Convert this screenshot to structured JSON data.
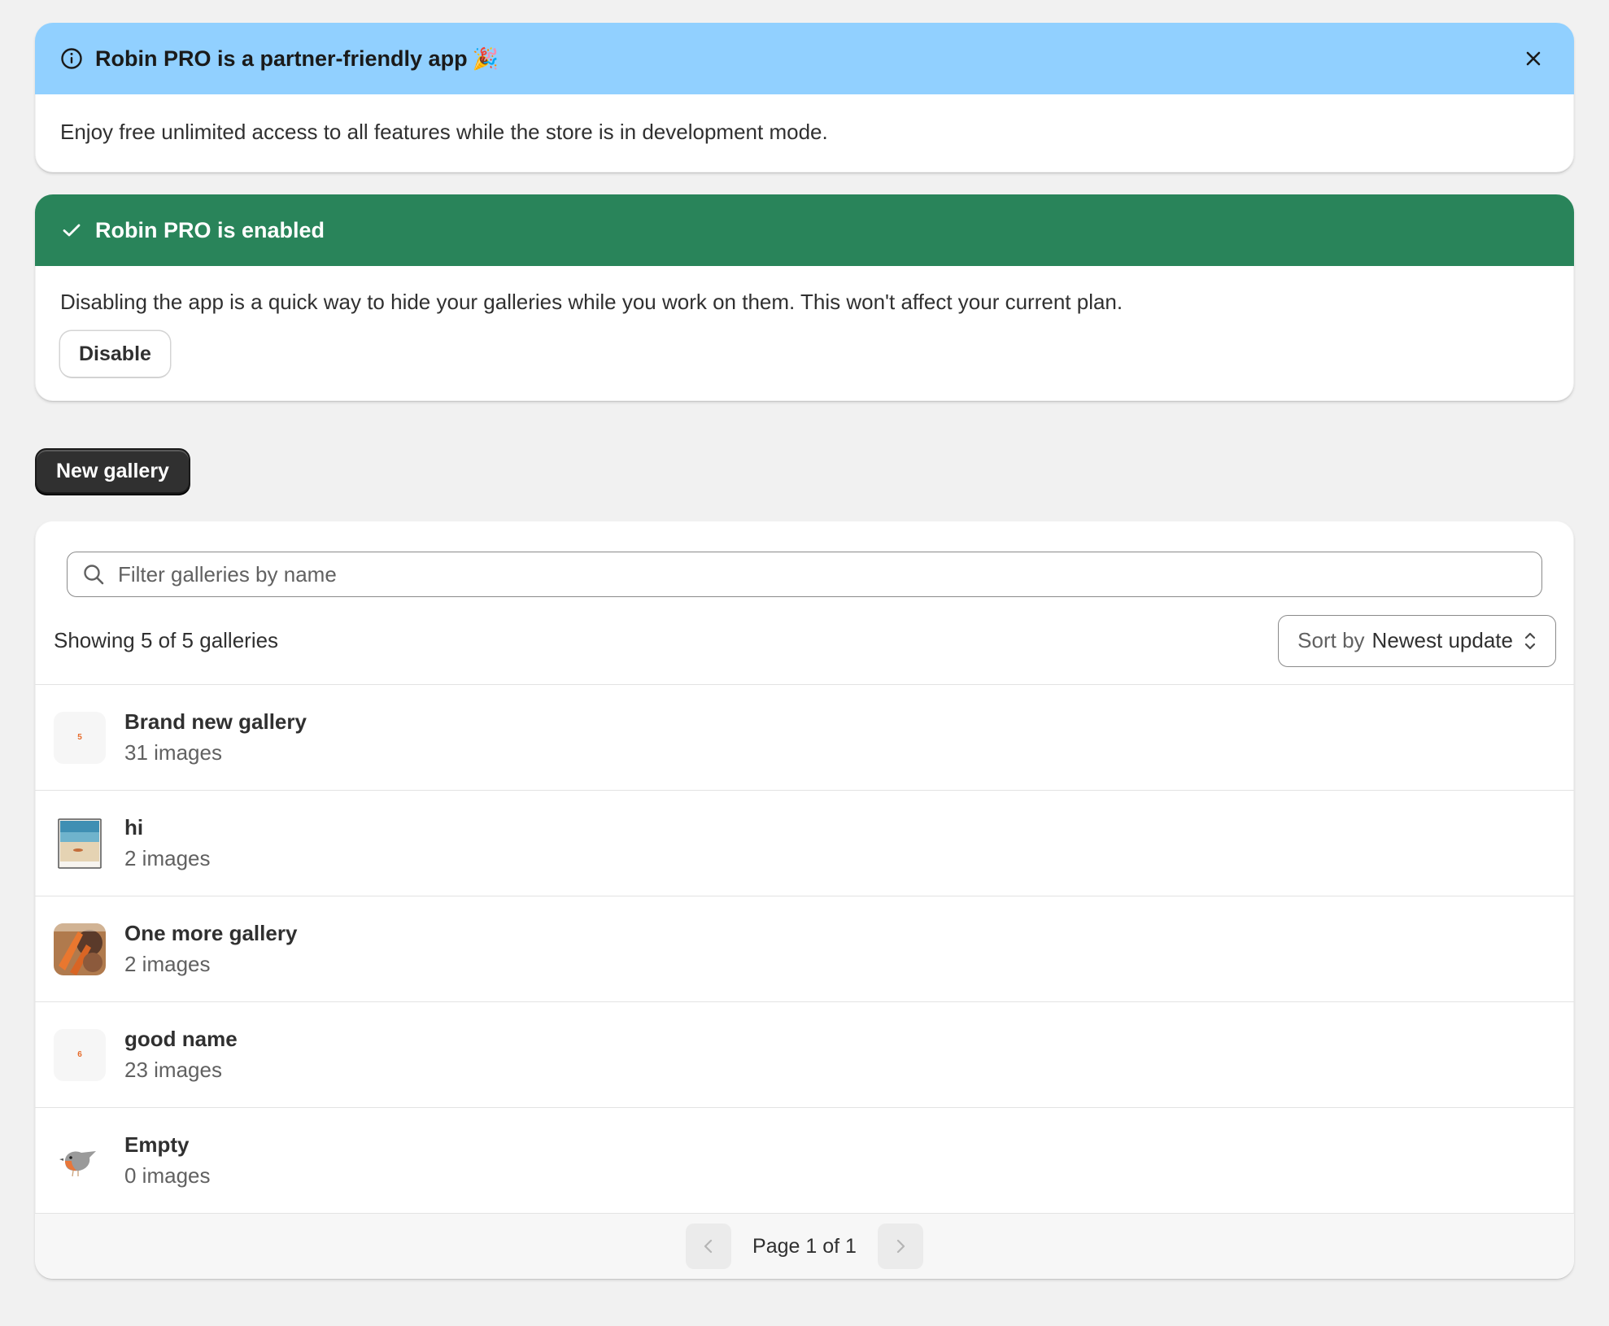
{
  "info_banner": {
    "title": "Robin PRO is a partner-friendly app",
    "emoji": "🎉",
    "body": "Enjoy free unlimited access to all features while the store is in development mode.",
    "color": "#91d0ff"
  },
  "status_banner": {
    "title": "Robin PRO is enabled",
    "body": "Disabling the app is a quick way to hide your galleries while you work on them. This won't affect your current plan.",
    "disable_label": "Disable",
    "color": "#29845a"
  },
  "new_gallery_label": "New gallery",
  "filter": {
    "placeholder": "Filter galleries by name",
    "value": ""
  },
  "summary": "Showing 5 of 5 galleries",
  "sort": {
    "prefix": "Sort by",
    "value": "Newest update"
  },
  "galleries": [
    {
      "name": "Brand new gallery",
      "count": "31 images",
      "thumb": "5"
    },
    {
      "name": "hi",
      "count": "2 images",
      "thumb": "beach-photo"
    },
    {
      "name": "One more gallery",
      "count": "2 images",
      "thumb": "food-photo"
    },
    {
      "name": "good name",
      "count": "23 images",
      "thumb": "6"
    },
    {
      "name": "Empty",
      "count": "0 images",
      "thumb": "robin-bird"
    }
  ],
  "pagination": {
    "label": "Page 1 of 1"
  }
}
